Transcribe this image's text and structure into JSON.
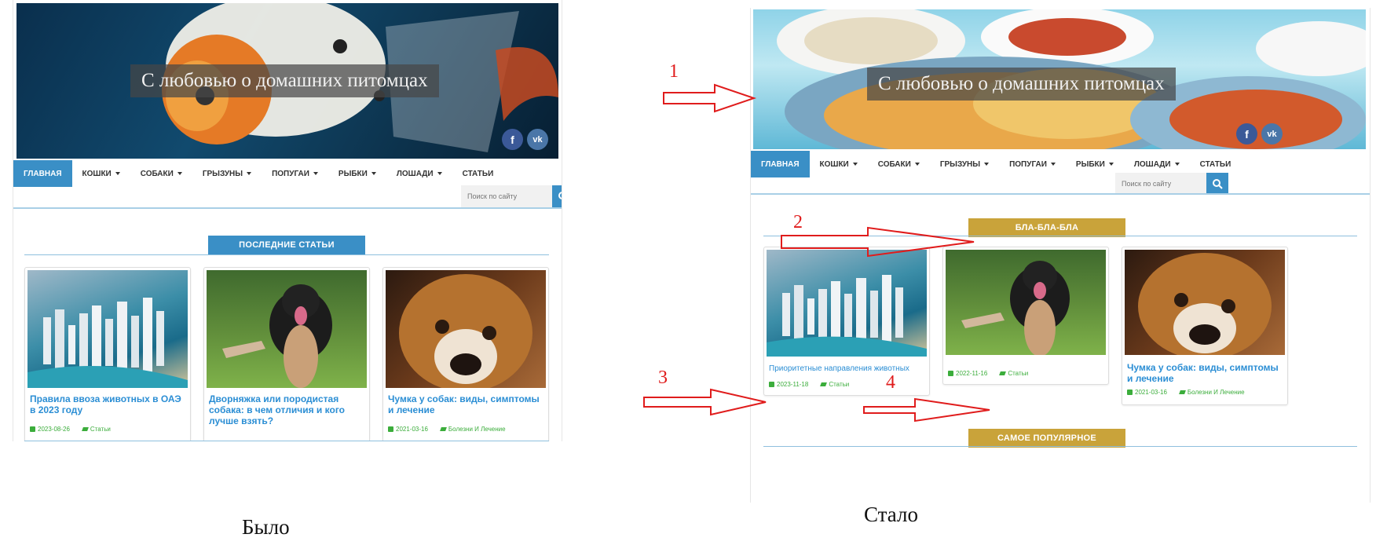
{
  "site": {
    "title": "С любовью о домашних питомцах",
    "nav": [
      "Главная",
      "Кошки",
      "Собаки",
      "Грызуны",
      "Попугаи",
      "Рыбки",
      "Лошади",
      "Статьи"
    ],
    "search_placeholder": "Поиск по сайту",
    "social": [
      "f",
      "vk"
    ]
  },
  "before": {
    "section_label": "Последние статьи",
    "cards": [
      {
        "title": "Правила ввоза животных в ОАЭ в 2023 году",
        "date": "2023-08-26",
        "category": "Статьи"
      },
      {
        "title": "Дворняжка или породистая собака: в чем отличия и кого лучше взять?",
        "date": "",
        "category": ""
      },
      {
        "title": "Чумка у собак: виды, симптомы и лечение",
        "date": "2021-03-16",
        "category": "Болезни И Лечение"
      }
    ],
    "caption": "Было"
  },
  "after": {
    "section_label": "бла-бла-бла",
    "section_label2": "Самое популярное",
    "cards": [
      {
        "title": "Приоритетные направления животных",
        "date": "2023-11-18",
        "category": "Статьи"
      },
      {
        "title": "",
        "date": "2022-11-16",
        "category": "Статьи"
      },
      {
        "title": "Чумка у собак: виды, симптомы и лечение",
        "date": "2021-03-16",
        "category": "Болезни И Лечение"
      }
    ],
    "caption": "Стало"
  },
  "annotations": [
    "1",
    "2",
    "3",
    "4"
  ],
  "colors": {
    "accent_blue": "#3a8fc6",
    "gold": "#c9a33a",
    "link": "#2b8ed4",
    "meta_green": "#3bad3b",
    "arrow_red": "#e01c1c"
  }
}
